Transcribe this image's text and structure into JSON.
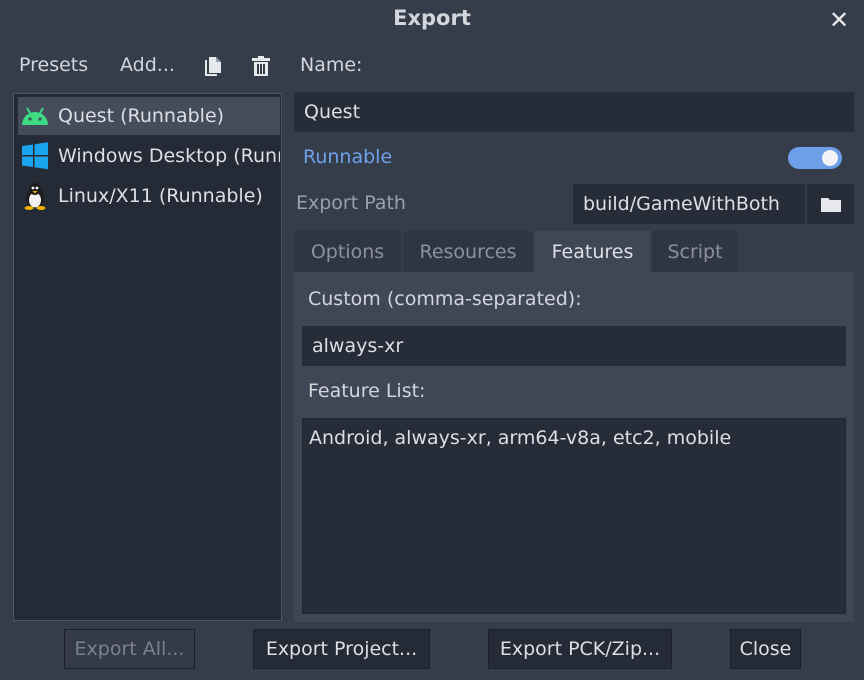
{
  "window": {
    "title": "Export",
    "close_symbol": "✕"
  },
  "toolbar": {
    "presets_label": "Presets",
    "add_label": "Add...",
    "duplicate_icon": "duplicate-icon",
    "delete_icon": "trash-icon"
  },
  "presets": [
    {
      "label": "Quest (Runnable)",
      "icon": "android-icon",
      "selected": true
    },
    {
      "label": "Windows Desktop (Runnable)",
      "icon": "windows-icon",
      "selected": false
    },
    {
      "label": "Linux/X11 (Runnable)",
      "icon": "linux-icon",
      "selected": false
    }
  ],
  "details": {
    "name_label": "Name:",
    "name_value": "Quest",
    "runnable_label": "Runnable",
    "runnable_on": true,
    "export_path_label": "Export Path",
    "export_path_value": "build/GameWithBoth",
    "folder_icon": "folder-icon"
  },
  "tabs": [
    {
      "label": "Options",
      "active": false
    },
    {
      "label": "Resources",
      "active": false
    },
    {
      "label": "Features",
      "active": true
    },
    {
      "label": "Script",
      "active": false
    }
  ],
  "features": {
    "custom_label": "Custom (comma-separated):",
    "custom_value": "always-xr",
    "feature_list_label": "Feature List:",
    "feature_list_value": "Android, always-xr, arm64-v8a, etc2, mobile"
  },
  "buttons": {
    "export_all": "Export All...",
    "export_project": "Export Project...",
    "export_pck": "Export PCK/Zip...",
    "close": "Close"
  },
  "colors": {
    "background": "#363d4a",
    "accent": "#6d9ee8",
    "android_green": "#3ddc84",
    "windows_blue": "#1aa4f0"
  }
}
